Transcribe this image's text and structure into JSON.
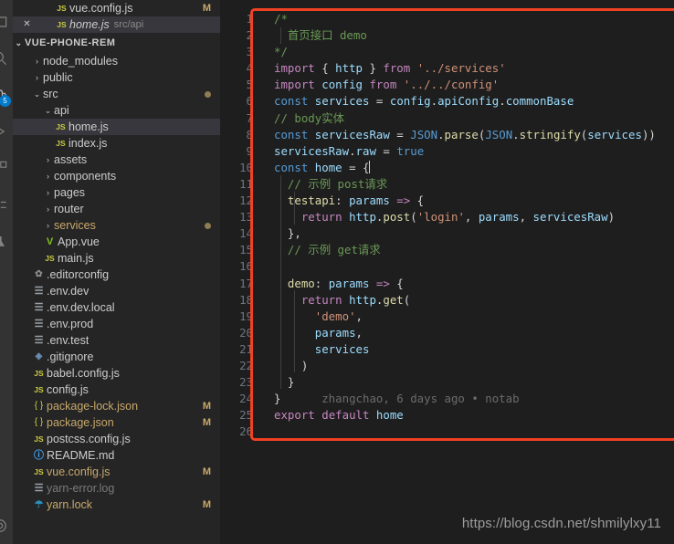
{
  "activity_bar": {
    "items": [
      {
        "name": "explorer-icon",
        "badge": ""
      },
      {
        "name": "search-icon",
        "badge": ""
      },
      {
        "name": "source-control-icon",
        "badge": "5"
      },
      {
        "name": "run-debug-icon",
        "badge": ""
      },
      {
        "name": "extensions-icon",
        "badge": ""
      },
      {
        "name": "remote-explorer-icon",
        "badge": ""
      },
      {
        "name": "test-icon",
        "badge": ""
      },
      {
        "name": "settings-gear-icon",
        "badge": ""
      }
    ]
  },
  "sidebar": {
    "open_editors": [
      {
        "icon": "js-file-icon",
        "name": "vue.config.js",
        "desc": "",
        "flag": "M",
        "selected": false,
        "close": false,
        "italic": false
      },
      {
        "icon": "js-file-icon",
        "name": "home.js",
        "desc": "src/api",
        "flag": "",
        "selected": true,
        "close": true,
        "italic": true
      }
    ],
    "project": {
      "label": "VUE-PHONE-REM",
      "expanded": true
    },
    "tree": [
      {
        "label": "node_modules",
        "type": "folder",
        "expanded": false,
        "indent": 1,
        "icon": "",
        "flag": "",
        "dot": false
      },
      {
        "label": "public",
        "type": "folder",
        "expanded": false,
        "indent": 1,
        "icon": "",
        "flag": "",
        "dot": false
      },
      {
        "label": "src",
        "type": "folder",
        "expanded": true,
        "indent": 1,
        "icon": "",
        "flag": "",
        "dot": true
      },
      {
        "label": "api",
        "type": "folder",
        "expanded": true,
        "indent": 2,
        "icon": "",
        "flag": "",
        "dot": false
      },
      {
        "label": "home.js",
        "type": "file",
        "indent": 3,
        "icon": "js-file-icon",
        "flag": "",
        "dot": false,
        "selected": true
      },
      {
        "label": "index.js",
        "type": "file",
        "indent": 3,
        "icon": "js-file-icon",
        "flag": "",
        "dot": false
      },
      {
        "label": "assets",
        "type": "folder",
        "expanded": false,
        "indent": 2,
        "icon": "",
        "flag": "",
        "dot": false
      },
      {
        "label": "components",
        "type": "folder",
        "expanded": false,
        "indent": 2,
        "icon": "",
        "flag": "",
        "dot": false
      },
      {
        "label": "pages",
        "type": "folder",
        "expanded": false,
        "indent": 2,
        "icon": "",
        "flag": "",
        "dot": false
      },
      {
        "label": "router",
        "type": "folder",
        "expanded": false,
        "indent": 2,
        "icon": "",
        "flag": "",
        "dot": false
      },
      {
        "label": "services",
        "type": "folder",
        "expanded": false,
        "indent": 2,
        "icon": "",
        "flag": "",
        "dot": true,
        "modified": true
      },
      {
        "label": "App.vue",
        "type": "file",
        "indent": 2,
        "icon": "vue-file-icon",
        "flag": "",
        "dot": false
      },
      {
        "label": "main.js",
        "type": "file",
        "indent": 2,
        "icon": "js-file-icon",
        "flag": "",
        "dot": false
      },
      {
        "label": ".editorconfig",
        "type": "file",
        "indent": 1,
        "icon": "gear-file-icon",
        "flag": "",
        "dot": false
      },
      {
        "label": ".env.dev",
        "type": "file",
        "indent": 1,
        "icon": "env-file-icon",
        "flag": "",
        "dot": false
      },
      {
        "label": ".env.dev.local",
        "type": "file",
        "indent": 1,
        "icon": "env-file-icon",
        "flag": "",
        "dot": false
      },
      {
        "label": ".env.prod",
        "type": "file",
        "indent": 1,
        "icon": "env-file-icon",
        "flag": "",
        "dot": false
      },
      {
        "label": ".env.test",
        "type": "file",
        "indent": 1,
        "icon": "env-file-icon",
        "flag": "",
        "dot": false
      },
      {
        "label": ".gitignore",
        "type": "file",
        "indent": 1,
        "icon": "git-file-icon",
        "flag": "",
        "dot": false
      },
      {
        "label": "babel.config.js",
        "type": "file",
        "indent": 1,
        "icon": "js-file-icon",
        "flag": "",
        "dot": false
      },
      {
        "label": "config.js",
        "type": "file",
        "indent": 1,
        "icon": "js-file-icon",
        "flag": "",
        "dot": false
      },
      {
        "label": "package-lock.json",
        "type": "file",
        "indent": 1,
        "icon": "json-file-icon",
        "flag": "M",
        "dot": false,
        "modified": true
      },
      {
        "label": "package.json",
        "type": "file",
        "indent": 1,
        "icon": "json-file-icon",
        "flag": "M",
        "dot": false,
        "modified": true
      },
      {
        "label": "postcss.config.js",
        "type": "file",
        "indent": 1,
        "icon": "js-file-icon",
        "flag": "",
        "dot": false
      },
      {
        "label": "README.md",
        "type": "file",
        "indent": 1,
        "icon": "md-file-icon",
        "flag": "",
        "dot": false
      },
      {
        "label": "vue.config.js",
        "type": "file",
        "indent": 1,
        "icon": "js-file-icon",
        "flag": "M",
        "dot": false,
        "modified": true
      },
      {
        "label": "yarn-error.log",
        "type": "file",
        "indent": 1,
        "icon": "log-file-icon",
        "flag": "",
        "dot": false,
        "dimmed": true
      },
      {
        "label": "yarn.lock",
        "type": "file",
        "indent": 1,
        "icon": "yarn-file-icon",
        "flag": "M",
        "dot": false,
        "modified": true
      }
    ]
  },
  "editor": {
    "file": "home.js",
    "blame_annotation": "zhangchao, 6 days ago • notab",
    "lines": [
      {
        "n": 1,
        "tokens": [
          {
            "t": "/*",
            "c": "t-cmt"
          }
        ]
      },
      {
        "n": 2,
        "tokens": [
          {
            "t": "  首页接口 demo",
            "c": "t-cmt"
          }
        ]
      },
      {
        "n": 3,
        "tokens": [
          {
            "t": "*/",
            "c": "t-cmt"
          }
        ]
      },
      {
        "n": 4,
        "tokens": [
          {
            "t": "import",
            "c": "t-kw"
          },
          {
            "t": " { ",
            "c": "t-p"
          },
          {
            "t": "http",
            "c": "t-var"
          },
          {
            "t": " } ",
            "c": "t-p"
          },
          {
            "t": "from",
            "c": "t-kw"
          },
          {
            "t": " ",
            "c": "t-p"
          },
          {
            "t": "'../services'",
            "c": "t-str"
          }
        ]
      },
      {
        "n": 5,
        "tokens": [
          {
            "t": "import",
            "c": "t-kw"
          },
          {
            "t": " ",
            "c": "t-p"
          },
          {
            "t": "config",
            "c": "t-var"
          },
          {
            "t": " ",
            "c": "t-p"
          },
          {
            "t": "from",
            "c": "t-kw"
          },
          {
            "t": " ",
            "c": "t-p"
          },
          {
            "t": "'../../config'",
            "c": "t-str"
          }
        ]
      },
      {
        "n": 6,
        "tokens": [
          {
            "t": "const",
            "c": "t-kw2"
          },
          {
            "t": " ",
            "c": "t-p"
          },
          {
            "t": "services",
            "c": "t-var"
          },
          {
            "t": " = ",
            "c": "t-p"
          },
          {
            "t": "config",
            "c": "t-var"
          },
          {
            "t": ".",
            "c": "t-p"
          },
          {
            "t": "apiConfig",
            "c": "t-var"
          },
          {
            "t": ".",
            "c": "t-p"
          },
          {
            "t": "commonBase",
            "c": "t-var"
          }
        ]
      },
      {
        "n": 7,
        "tokens": [
          {
            "t": "// body实体",
            "c": "t-cmt"
          }
        ]
      },
      {
        "n": 8,
        "tokens": [
          {
            "t": "const",
            "c": "t-kw2"
          },
          {
            "t": " ",
            "c": "t-p"
          },
          {
            "t": "servicesRaw",
            "c": "t-var"
          },
          {
            "t": " = ",
            "c": "t-p"
          },
          {
            "t": "JSON",
            "c": "t-kw2"
          },
          {
            "t": ".",
            "c": "t-p"
          },
          {
            "t": "parse",
            "c": "t-fn"
          },
          {
            "t": "(",
            "c": "t-p"
          },
          {
            "t": "JSON",
            "c": "t-kw2"
          },
          {
            "t": ".",
            "c": "t-p"
          },
          {
            "t": "stringify",
            "c": "t-fn"
          },
          {
            "t": "(",
            "c": "t-p"
          },
          {
            "t": "services",
            "c": "t-var"
          },
          {
            "t": "))",
            "c": "t-p"
          }
        ]
      },
      {
        "n": 9,
        "tokens": [
          {
            "t": "servicesRaw",
            "c": "t-var"
          },
          {
            "t": ".",
            "c": "t-p"
          },
          {
            "t": "raw",
            "c": "t-var"
          },
          {
            "t": " = ",
            "c": "t-p"
          },
          {
            "t": "true",
            "c": "t-kw2"
          }
        ]
      },
      {
        "n": 10,
        "tokens": [
          {
            "t": "const",
            "c": "t-kw2"
          },
          {
            "t": " ",
            "c": "t-p"
          },
          {
            "t": "home",
            "c": "t-var"
          },
          {
            "t": " = ",
            "c": "t-p"
          },
          {
            "t": "{",
            "c": "t-p"
          }
        ]
      },
      {
        "n": 11,
        "tokens": [
          {
            "t": "  // 示例 post请求",
            "c": "t-cmt"
          }
        ]
      },
      {
        "n": 12,
        "tokens": [
          {
            "t": "  ",
            "c": "t-p"
          },
          {
            "t": "testapi",
            "c": "t-fn"
          },
          {
            "t": ": ",
            "c": "t-p"
          },
          {
            "t": "params",
            "c": "t-var"
          },
          {
            "t": " ",
            "c": "t-p"
          },
          {
            "t": "=>",
            "c": "t-kw"
          },
          {
            "t": " {",
            "c": "t-p"
          }
        ]
      },
      {
        "n": 13,
        "tokens": [
          {
            "t": "    ",
            "c": "t-p"
          },
          {
            "t": "return",
            "c": "t-kw"
          },
          {
            "t": " ",
            "c": "t-p"
          },
          {
            "t": "http",
            "c": "t-var"
          },
          {
            "t": ".",
            "c": "t-p"
          },
          {
            "t": "post",
            "c": "t-fn"
          },
          {
            "t": "(",
            "c": "t-p"
          },
          {
            "t": "'login'",
            "c": "t-str"
          },
          {
            "t": ", ",
            "c": "t-p"
          },
          {
            "t": "params",
            "c": "t-var"
          },
          {
            "t": ", ",
            "c": "t-p"
          },
          {
            "t": "servicesRaw",
            "c": "t-var"
          },
          {
            "t": ")",
            "c": "t-p"
          }
        ]
      },
      {
        "n": 14,
        "tokens": [
          {
            "t": "  },",
            "c": "t-p"
          }
        ]
      },
      {
        "n": 15,
        "tokens": [
          {
            "t": "  // 示例 get请求",
            "c": "t-cmt"
          }
        ]
      },
      {
        "n": 16,
        "tokens": []
      },
      {
        "n": 17,
        "tokens": [
          {
            "t": "  ",
            "c": "t-p"
          },
          {
            "t": "demo",
            "c": "t-fn"
          },
          {
            "t": ": ",
            "c": "t-p"
          },
          {
            "t": "params",
            "c": "t-var"
          },
          {
            "t": " ",
            "c": "t-p"
          },
          {
            "t": "=>",
            "c": "t-kw"
          },
          {
            "t": " {",
            "c": "t-p"
          }
        ]
      },
      {
        "n": 18,
        "tokens": [
          {
            "t": "    ",
            "c": "t-p"
          },
          {
            "t": "return",
            "c": "t-kw"
          },
          {
            "t": " ",
            "c": "t-p"
          },
          {
            "t": "http",
            "c": "t-var"
          },
          {
            "t": ".",
            "c": "t-p"
          },
          {
            "t": "get",
            "c": "t-fn"
          },
          {
            "t": "(",
            "c": "t-p"
          }
        ]
      },
      {
        "n": 19,
        "tokens": [
          {
            "t": "      ",
            "c": "t-p"
          },
          {
            "t": "'demo'",
            "c": "t-str"
          },
          {
            "t": ",",
            "c": "t-p"
          }
        ]
      },
      {
        "n": 20,
        "tokens": [
          {
            "t": "      ",
            "c": "t-p"
          },
          {
            "t": "params",
            "c": "t-var"
          },
          {
            "t": ",",
            "c": "t-p"
          }
        ]
      },
      {
        "n": 21,
        "tokens": [
          {
            "t": "      ",
            "c": "t-p"
          },
          {
            "t": "services",
            "c": "t-var"
          }
        ]
      },
      {
        "n": 22,
        "tokens": [
          {
            "t": "    )",
            "c": "t-p"
          }
        ]
      },
      {
        "n": 23,
        "tokens": [
          {
            "t": "  }",
            "c": "t-p"
          }
        ]
      },
      {
        "n": 24,
        "tokens": [
          {
            "t": "}",
            "c": "t-p"
          },
          {
            "t": "      zhangchao, 6 days ago • notab",
            "c": "t-blame"
          }
        ]
      },
      {
        "n": 25,
        "tokens": [
          {
            "t": "export",
            "c": "t-kw"
          },
          {
            "t": " ",
            "c": "t-p"
          },
          {
            "t": "default",
            "c": "t-kw"
          },
          {
            "t": " ",
            "c": "t-p"
          },
          {
            "t": "home",
            "c": "t-var"
          }
        ]
      },
      {
        "n": 26,
        "tokens": []
      }
    ]
  },
  "annotation": {
    "redbox_color": "#ef4123",
    "watermark": "https://blog.csdn.net/shmilylxy11"
  }
}
